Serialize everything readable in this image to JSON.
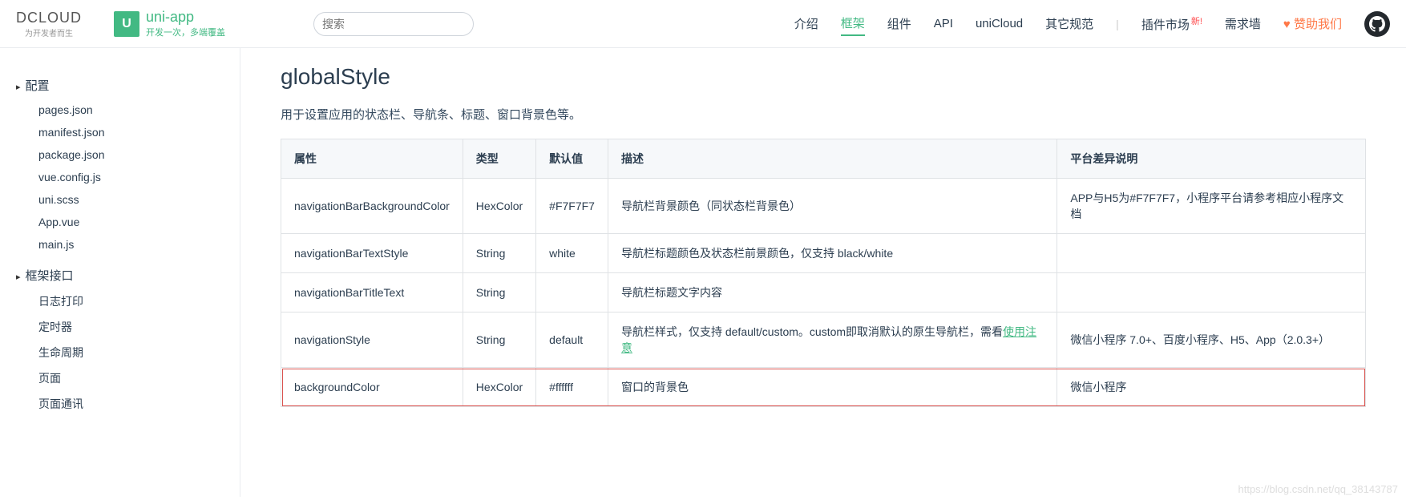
{
  "header": {
    "dcloud_logo": "DCLOUD",
    "dcloud_tagline": "为开发者而生",
    "uni_logo_letter": "U",
    "uni_title": "uni-app",
    "uni_tagline": "开发一次，多端覆盖",
    "search_placeholder": "搜索"
  },
  "nav": {
    "items": [
      "介绍",
      "框架",
      "组件",
      "API",
      "uniCloud",
      "其它规范"
    ],
    "active_index": 1,
    "plugin_market": "插件市场",
    "new_tag": "新!",
    "request_wall": "需求墙",
    "sponsor": "赞助我们"
  },
  "sidebar": {
    "groups": [
      {
        "title": "配置",
        "items": [
          "pages.json",
          "manifest.json",
          "package.json",
          "vue.config.js",
          "uni.scss",
          "App.vue",
          "main.js"
        ]
      },
      {
        "title": "框架接口",
        "items": [
          "日志打印",
          "定时器",
          "生命周期",
          "页面",
          "页面通讯"
        ]
      }
    ]
  },
  "content": {
    "title": "globalStyle",
    "intro": "用于设置应用的状态栏、导航条、标题、窗口背景色等。",
    "table_headers": [
      "属性",
      "类型",
      "默认值",
      "描述",
      "平台差异说明"
    ],
    "rows": [
      {
        "prop": "navigationBarBackgroundColor",
        "type": "HexColor",
        "default": "#F7F7F7",
        "desc": "导航栏背景颜色（同状态栏背景色）",
        "platform": "APP与H5为#F7F7F7，小程序平台请参考相应小程序文档"
      },
      {
        "prop": "navigationBarTextStyle",
        "type": "String",
        "default": "white",
        "desc": "导航栏标题颜色及状态栏前景颜色，仅支持 black/white",
        "platform": ""
      },
      {
        "prop": "navigationBarTitleText",
        "type": "String",
        "default": "",
        "desc": "导航栏标题文字内容",
        "platform": ""
      },
      {
        "prop": "navigationStyle",
        "type": "String",
        "default": "default",
        "desc_prefix": "导航栏样式，仅支持 default/custom。custom即取消默认的原生导航栏，需看",
        "desc_link": "使用注意",
        "platform": "微信小程序 7.0+、百度小程序、H5、App（2.0.3+）"
      },
      {
        "prop": "backgroundColor",
        "type": "HexColor",
        "default": "#ffffff",
        "desc": "窗口的背景色",
        "platform": "微信小程序",
        "highlighted": true
      }
    ]
  },
  "watermark": "https://blog.csdn.net/qq_38143787"
}
